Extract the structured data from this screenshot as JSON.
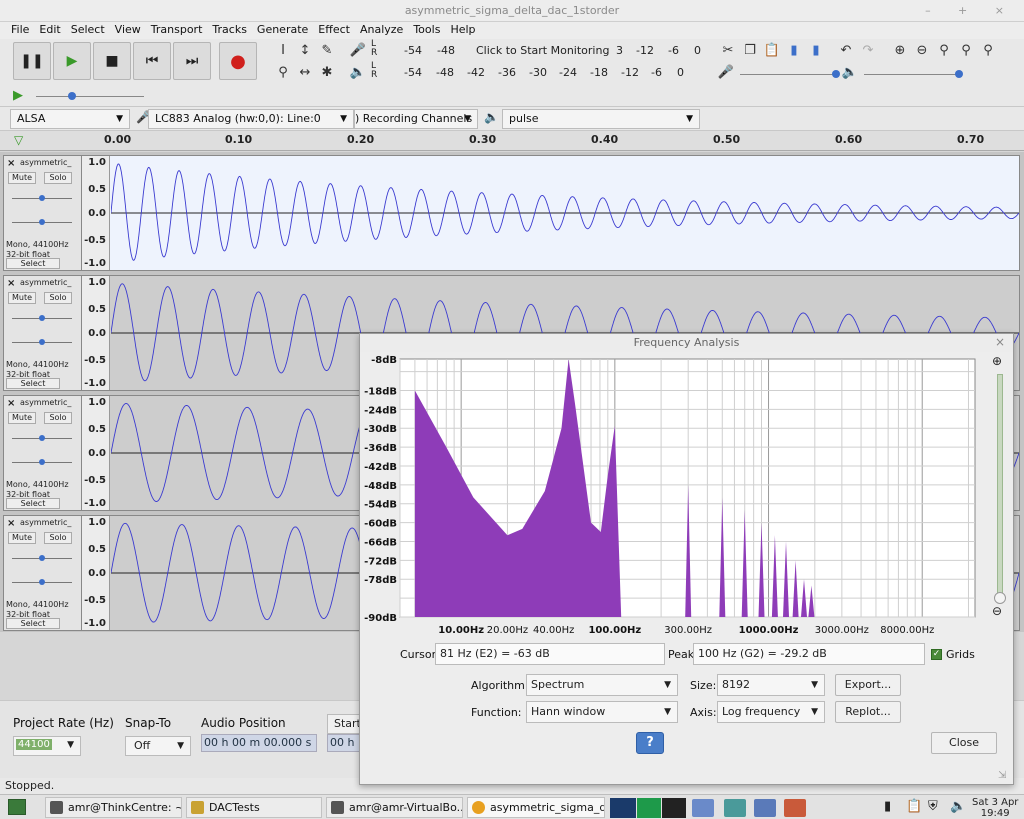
{
  "window": {
    "title": "asymmetric_sigma_delta_dac_1storder",
    "controls": "– + ×"
  },
  "menu": [
    "File",
    "Edit",
    "Select",
    "View",
    "Transport",
    "Tracks",
    "Generate",
    "Effect",
    "Analyze",
    "Tools",
    "Help"
  ],
  "meter": {
    "record_scale": [
      "-54",
      "-48",
      "-12",
      "-6",
      "0"
    ],
    "record_prompt": "Click to Start Monitoring",
    "record_fragment": "3",
    "play_scale": [
      "-54",
      "-48",
      "-42",
      "-36",
      "-30",
      "-24",
      "-18",
      "-12",
      "-6",
      "0"
    ],
    "lr": [
      "L",
      "R"
    ]
  },
  "device": {
    "host": "ALSA",
    "record_device": "LC883 Analog (hw:0,0): Line:0",
    "channels": ") Recording Channels",
    "playback_device": "pulse"
  },
  "ruler": {
    "ticks": [
      "0.00",
      "0.10",
      "0.20",
      "0.30",
      "0.40",
      "0.50",
      "0.60",
      "0.70"
    ]
  },
  "tracks": [
    {
      "name": "asymmetric_",
      "mute": "Mute",
      "solo": "Solo",
      "info1": "Mono, 44100Hz",
      "info2": "32-bit float",
      "select": "Select",
      "scale": [
        "1.0",
        "0.5",
        "0.0",
        "-0.5",
        "-1.0"
      ]
    },
    {
      "name": "asymmetric_",
      "mute": "Mute",
      "solo": "Solo",
      "info1": "Mono, 44100Hz",
      "info2": "32-bit float",
      "select": "Select",
      "scale": [
        "1.0",
        "0.5",
        "0.0",
        "-0.5",
        "-1.0"
      ]
    },
    {
      "name": "asymmetric_",
      "mute": "Mute",
      "solo": "Solo",
      "info1": "Mono, 44100Hz",
      "info2": "32-bit float",
      "select": "Select",
      "scale": [
        "1.0",
        "0.5",
        "0.0",
        "-0.5",
        "-1.0"
      ]
    },
    {
      "name": "asymmetric_",
      "mute": "Mute",
      "solo": "Solo",
      "info1": "Mono, 44100Hz",
      "info2": "32-bit float",
      "select": "Select",
      "scale": [
        "1.0",
        "0.5",
        "0.0",
        "-0.5",
        "-1.0"
      ]
    }
  ],
  "bottom": {
    "rate_label": "Project Rate (Hz)",
    "rate_value": "44100",
    "snap_label": "Snap-To",
    "snap_value": "Off",
    "pos_label": "Audio Position",
    "pos_value": "00 h 00 m 00.000 s",
    "start_label": "Start",
    "start_fragment": "00 h"
  },
  "status": "Stopped.",
  "freq": {
    "title": "Frequency Analysis",
    "db_labels": [
      "-8dB",
      "-18dB",
      "-24dB",
      "-30dB",
      "-36dB",
      "-42dB",
      "-48dB",
      "-54dB",
      "-60dB",
      "-66dB",
      "-72dB",
      "-78dB",
      "-90dB"
    ],
    "hz_labels": [
      "10.00Hz",
      "20.00Hz",
      "40.00Hz",
      "100.00Hz",
      "300.00Hz",
      "1000.00Hz",
      "3000.00Hz",
      "8000.00Hz"
    ],
    "cursor_label": "Cursor:",
    "cursor_value": "81 Hz (E2) = -63 dB",
    "peak_label": "Peak:",
    "peak_value": "100 Hz (G2) = -29.2 dB",
    "grids_label": "Grids",
    "algorithm_label": "Algorithm:",
    "algorithm_value": "Spectrum",
    "size_label": "Size:",
    "size_value": "8192",
    "function_label": "Function:",
    "function_value": "Hann window",
    "axis_label": "Axis:",
    "axis_value": "Log frequency",
    "export": "Export...",
    "replot": "Replot...",
    "close": "Close",
    "help": "?",
    "fill_color": "#8e3cb8"
  },
  "taskbar": {
    "items": [
      "amr@ThinkCentre: ~...",
      "DACTests",
      "amr@amr-VirtualBo...",
      "asymmetric_sigma_d..."
    ],
    "date": "Sat 3 Apr",
    "time": "19:49"
  },
  "chart_data": {
    "type": "area",
    "title": "Frequency Analysis",
    "xscale": "log",
    "x_unit": "Hz",
    "y_unit": "dB",
    "ylim": [
      -90,
      -8
    ],
    "x": [
      5,
      8,
      12,
      20,
      25,
      35,
      45,
      50,
      55,
      70,
      81,
      90,
      100,
      110,
      300,
      1000
    ],
    "values": [
      -18,
      -36,
      -52,
      -64,
      -62,
      -50,
      -30,
      -8,
      -22,
      -60,
      -63,
      -45,
      -29.2,
      -90,
      -90,
      -90
    ],
    "harmonic_peaks": [
      {
        "x": 300,
        "y": -48
      },
      {
        "x": 500,
        "y": -52
      },
      {
        "x": 700,
        "y": -56
      },
      {
        "x": 900,
        "y": -60
      },
      {
        "x": 1100,
        "y": -64
      },
      {
        "x": 1300,
        "y": -66
      },
      {
        "x": 1500,
        "y": -72
      },
      {
        "x": 1700,
        "y": -78
      },
      {
        "x": 1900,
        "y": -80
      }
    ],
    "grid": true
  }
}
